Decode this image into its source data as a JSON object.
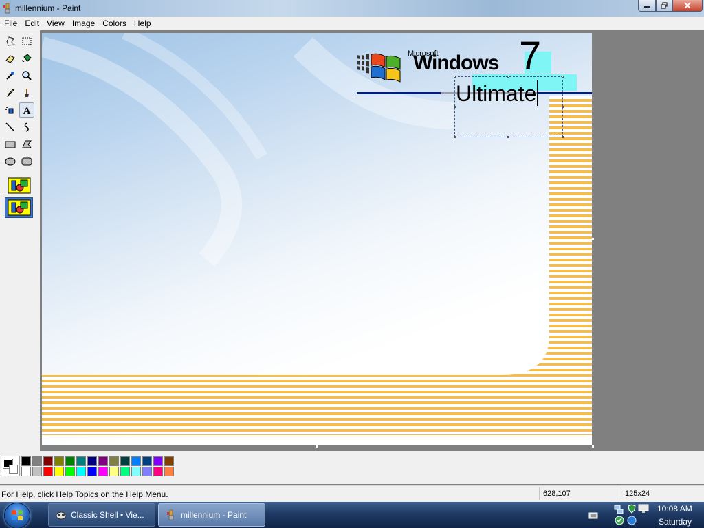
{
  "window": {
    "title": "millennium - Paint"
  },
  "menu": [
    "File",
    "Edit",
    "View",
    "Image",
    "Colors",
    "Help"
  ],
  "canvas_text": {
    "microsoft": "Microsoft",
    "windows": "Windows",
    "version": "7",
    "edition": "Ultimate"
  },
  "palette": {
    "foreground": "#000000",
    "background": "#ffffff",
    "row1": [
      "#000000",
      "#808080",
      "#800000",
      "#808000",
      "#008000",
      "#008080",
      "#000080",
      "#800080",
      "#808040",
      "#004040",
      "#0080ff",
      "#004080",
      "#8000ff",
      "#804000"
    ],
    "row2": [
      "#ffffff",
      "#c0c0c0",
      "#ff0000",
      "#ffff00",
      "#00ff00",
      "#00ffff",
      "#0000ff",
      "#ff00ff",
      "#ffff80",
      "#00ff80",
      "#80ffff",
      "#8080ff",
      "#ff0080",
      "#ff8040"
    ]
  },
  "status": {
    "help": "For Help, click Help Topics on the Help Menu.",
    "coords": "628,107",
    "size": "125x24"
  },
  "taskbar": {
    "tasks": [
      "Classic Shell • Vie...",
      "millennium - Paint"
    ],
    "time": "10:08 AM",
    "day": "Saturday"
  }
}
